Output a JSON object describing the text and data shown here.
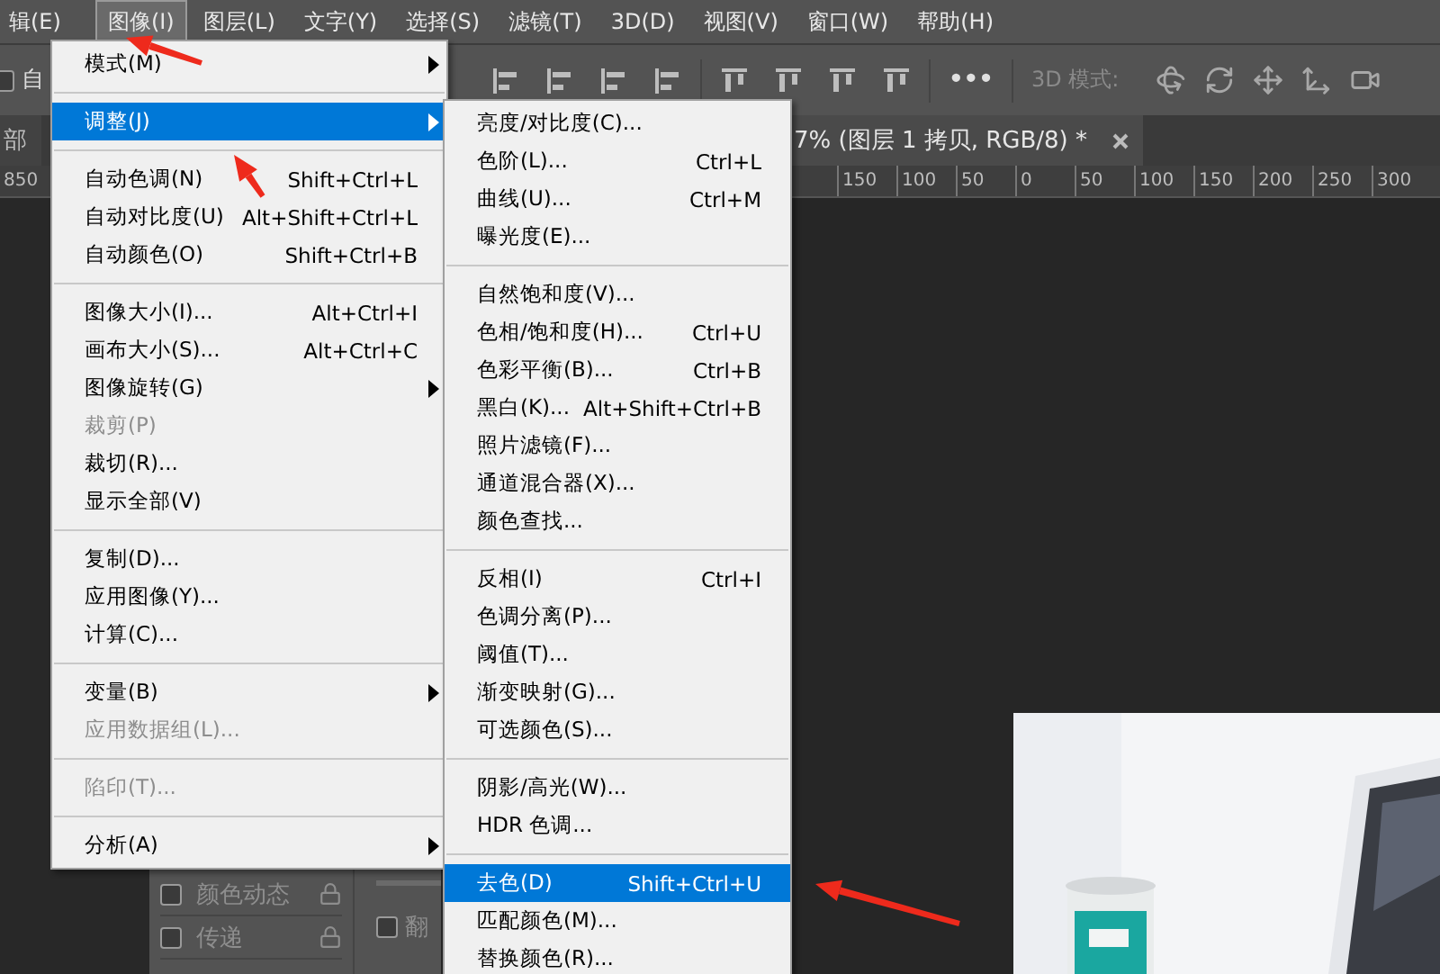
{
  "menubar": {
    "items": [
      {
        "label": "辑(E)",
        "selected": false
      },
      {
        "label": "图像(I)",
        "selected": true
      },
      {
        "label": "图层(L)",
        "selected": false
      },
      {
        "label": "文字(Y)",
        "selected": false
      },
      {
        "label": "选择(S)",
        "selected": false
      },
      {
        "label": "滤镜(T)",
        "selected": false
      },
      {
        "label": "3D(D)",
        "selected": false
      },
      {
        "label": "视图(V)",
        "selected": false
      },
      {
        "label": "窗口(W)",
        "selected": false
      },
      {
        "label": "帮助(H)",
        "selected": false
      }
    ]
  },
  "options_bar": {
    "auto_checkbox": {
      "label": "自",
      "checked": false
    },
    "more": "•••",
    "mode_label": "3D 模式:"
  },
  "tabs": [
    {
      "label": "部",
      "selected": false
    },
    {
      "label": "7% (图层 1 拷贝, RGB/8) *",
      "selected": true
    }
  ],
  "ruler": {
    "left_labels": [
      "850"
    ],
    "labels": [
      "150",
      "100",
      "50",
      "0",
      "50",
      "100",
      "150",
      "200",
      "250",
      "300"
    ]
  },
  "panel": {
    "rows": [
      {
        "label": "颜色动态",
        "checked": false,
        "locked": true
      },
      {
        "label": "传递",
        "checked": false,
        "locked": true
      }
    ],
    "side_checkbox": {
      "label": "翻",
      "checked": false
    }
  },
  "menu": {
    "items": [
      {
        "kind": "item",
        "label": "模式(M)",
        "submenu": true,
        "selected": false,
        "disabled": false
      },
      {
        "kind": "separator"
      },
      {
        "kind": "item",
        "label": "调整(J)",
        "submenu": true,
        "selected": true,
        "disabled": false
      },
      {
        "kind": "separator"
      },
      {
        "kind": "item",
        "label": "自动色调(N)",
        "shortcut": "Shift+Ctrl+L",
        "selected": false,
        "disabled": false
      },
      {
        "kind": "item",
        "label": "自动对比度(U)",
        "shortcut": "Alt+Shift+Ctrl+L",
        "selected": false,
        "disabled": false
      },
      {
        "kind": "item",
        "label": "自动颜色(O)",
        "shortcut": "Shift+Ctrl+B",
        "selected": false,
        "disabled": false
      },
      {
        "kind": "separator"
      },
      {
        "kind": "item",
        "label": "图像大小(I)...",
        "shortcut": "Alt+Ctrl+I",
        "selected": false,
        "disabled": false
      },
      {
        "kind": "item",
        "label": "画布大小(S)...",
        "shortcut": "Alt+Ctrl+C",
        "selected": false,
        "disabled": false
      },
      {
        "kind": "item",
        "label": "图像旋转(G)",
        "submenu": true,
        "selected": false,
        "disabled": false
      },
      {
        "kind": "item",
        "label": "裁剪(P)",
        "selected": false,
        "disabled": true
      },
      {
        "kind": "item",
        "label": "裁切(R)...",
        "selected": false,
        "disabled": false
      },
      {
        "kind": "item",
        "label": "显示全部(V)",
        "selected": false,
        "disabled": false
      },
      {
        "kind": "separator"
      },
      {
        "kind": "item",
        "label": "复制(D)...",
        "selected": false,
        "disabled": false
      },
      {
        "kind": "item",
        "label": "应用图像(Y)...",
        "selected": false,
        "disabled": false
      },
      {
        "kind": "item",
        "label": "计算(C)...",
        "selected": false,
        "disabled": false
      },
      {
        "kind": "separator"
      },
      {
        "kind": "item",
        "label": "变量(B)",
        "submenu": true,
        "selected": false,
        "disabled": false
      },
      {
        "kind": "item",
        "label": "应用数据组(L)...",
        "selected": false,
        "disabled": true
      },
      {
        "kind": "separator"
      },
      {
        "kind": "item",
        "label": "陷印(T)...",
        "selected": false,
        "disabled": true
      },
      {
        "kind": "separator"
      },
      {
        "kind": "item",
        "label": "分析(A)",
        "submenu": true,
        "selected": false,
        "disabled": false
      }
    ]
  },
  "submenu": {
    "items": [
      {
        "kind": "item",
        "label": "亮度/对比度(C)...",
        "selected": false
      },
      {
        "kind": "item",
        "label": "色阶(L)...",
        "shortcut": "Ctrl+L",
        "selected": false
      },
      {
        "kind": "item",
        "label": "曲线(U)...",
        "shortcut": "Ctrl+M",
        "selected": false
      },
      {
        "kind": "item",
        "label": "曝光度(E)...",
        "selected": false
      },
      {
        "kind": "separator"
      },
      {
        "kind": "item",
        "label": "自然饱和度(V)...",
        "selected": false
      },
      {
        "kind": "item",
        "label": "色相/饱和度(H)...",
        "shortcut": "Ctrl+U",
        "selected": false
      },
      {
        "kind": "item",
        "label": "色彩平衡(B)...",
        "shortcut": "Ctrl+B",
        "selected": false
      },
      {
        "kind": "item",
        "label": "黑白(K)...",
        "shortcut": "Alt+Shift+Ctrl+B",
        "selected": false
      },
      {
        "kind": "item",
        "label": "照片滤镜(F)...",
        "selected": false
      },
      {
        "kind": "item",
        "label": "通道混合器(X)...",
        "selected": false
      },
      {
        "kind": "item",
        "label": "颜色查找...",
        "selected": false
      },
      {
        "kind": "separator"
      },
      {
        "kind": "item",
        "label": "反相(I)",
        "shortcut": "Ctrl+I",
        "selected": false
      },
      {
        "kind": "item",
        "label": "色调分离(P)...",
        "selected": false
      },
      {
        "kind": "item",
        "label": "阈值(T)...",
        "selected": false
      },
      {
        "kind": "item",
        "label": "渐变映射(G)...",
        "selected": false
      },
      {
        "kind": "item",
        "label": "可选颜色(S)...",
        "selected": false
      },
      {
        "kind": "separator"
      },
      {
        "kind": "item",
        "label": "阴影/高光(W)...",
        "selected": false
      },
      {
        "kind": "item",
        "label": "HDR 色调...",
        "selected": false
      },
      {
        "kind": "separator"
      },
      {
        "kind": "item",
        "label": "去色(D)",
        "shortcut": "Shift+Ctrl+U",
        "selected": true
      },
      {
        "kind": "item",
        "label": "匹配颜色(M)...",
        "selected": false
      },
      {
        "kind": "item",
        "label": "替换颜色(R)...",
        "selected": false
      }
    ]
  }
}
